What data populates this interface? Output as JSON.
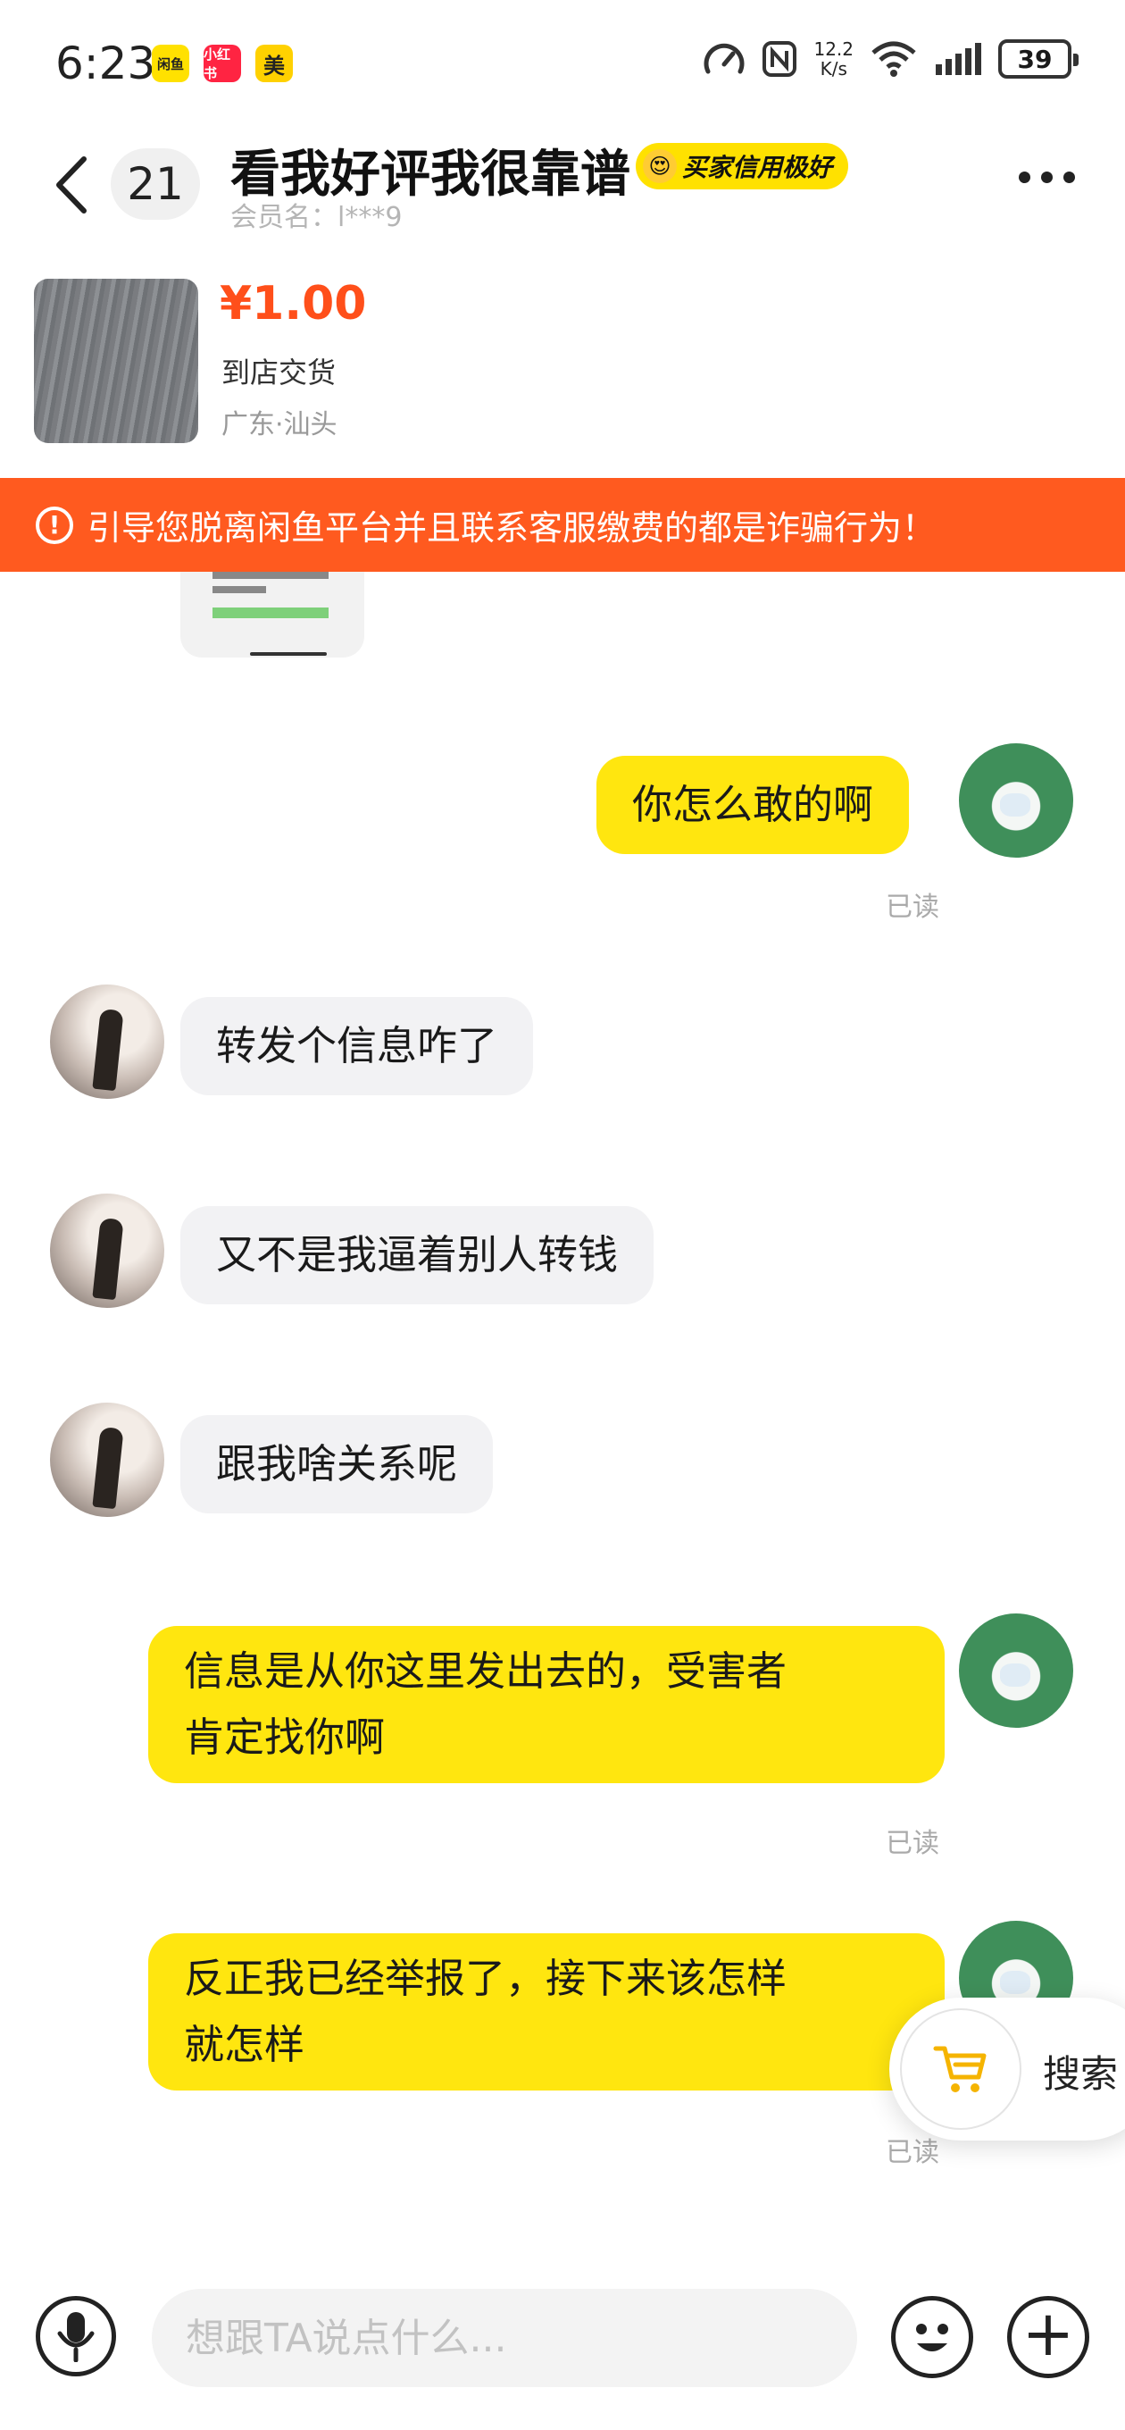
{
  "status_bar": {
    "time": "6:23",
    "apps": [
      "闲鱼",
      "小红书",
      "美"
    ],
    "net_speed_value": "12.2",
    "net_speed_unit": "K/s",
    "battery": "39"
  },
  "header": {
    "unread_count": "21",
    "title": "看我好评我很靠谱",
    "credit_badge": "买家信用极好",
    "member_label": "会员名：l***9"
  },
  "product": {
    "price": "¥1.00",
    "delivery": "到店交货",
    "location": "广东·汕头"
  },
  "warning": {
    "text": "引导您脱离闲鱼平台并且联系客服缴费的都是诈骗行为！"
  },
  "messages": [
    {
      "from": "me",
      "lines": [
        "你怎么敢的啊"
      ],
      "status": "已读"
    },
    {
      "from": "other",
      "lines": [
        "转发个信息咋了"
      ]
    },
    {
      "from": "other",
      "lines": [
        "又不是我逼着别人转钱"
      ]
    },
    {
      "from": "other",
      "lines": [
        "跟我啥关系呢"
      ]
    },
    {
      "from": "me",
      "lines": [
        "信息是从你这里发出去的，受害者",
        "肯定找你啊"
      ],
      "status": "已读"
    },
    {
      "from": "me",
      "lines": [
        "反正我已经举报了，接下来该怎样",
        "就怎样"
      ],
      "status": "已读"
    }
  ],
  "floating_action": {
    "label": "搜索"
  },
  "input": {
    "placeholder": "想跟TA说点什么..."
  },
  "colors": {
    "accent_yellow": "#ffe60f",
    "warning_orange": "#ff5a1f",
    "price_orange": "#ff4f1a"
  }
}
